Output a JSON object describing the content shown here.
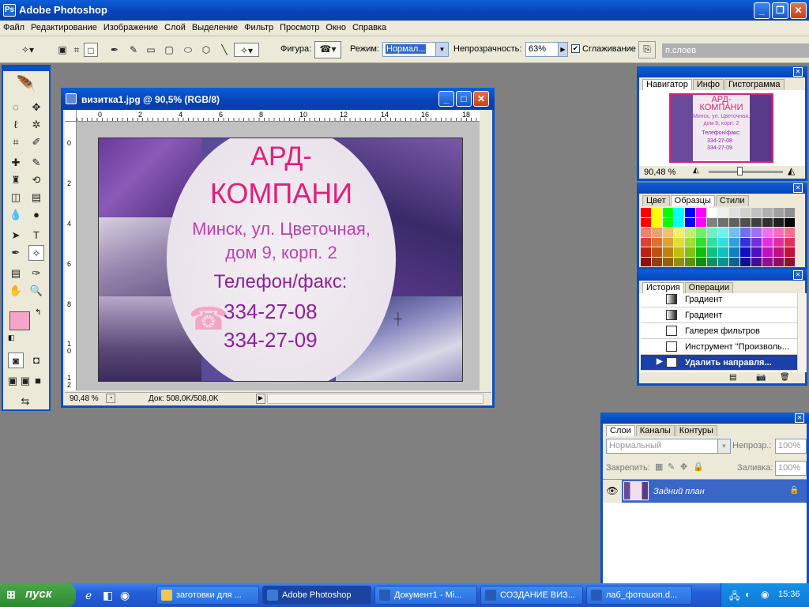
{
  "app": {
    "title": "Adobe Photoshop"
  },
  "menu": [
    "Файл",
    "Редактирование",
    "Изображение",
    "Слой",
    "Выделение",
    "Фильтр",
    "Просмотр",
    "Окно",
    "Справка"
  ],
  "options": {
    "shape_label": "Фигура:",
    "mode_label": "Режим:",
    "mode_value": "Нормал...",
    "opacity_label": "Непрозрачность:",
    "opacity_value": "63%",
    "antialias_label": "Сглаживание",
    "antialias_checked": true,
    "layers_tab": "п.слоев"
  },
  "document": {
    "title": "визитка1.jpg @ 90,5% (RGB/8)",
    "zoom": "90,48 %",
    "doc_size": "Док: 508,0K/508,0K",
    "ruler_h": [
      "0",
      "2",
      "4",
      "6",
      "8",
      "10",
      "12",
      "14",
      "16",
      "18"
    ],
    "ruler_v": [
      "0",
      "2",
      "4",
      "6",
      "8",
      "1\n0",
      "1\n2"
    ]
  },
  "card": {
    "line1": "АРД-",
    "line2": "КОМПАНИ",
    "address1": "Минск, ул. Цветочная,",
    "address2": "дом 9, корп. 2",
    "phone_label": "Телефон/факс:",
    "phone1": "334-27-08",
    "phone2": "334-27-09",
    "title_color": "#e0207a",
    "address_color": "#c040b0",
    "phone_color": "#9020a0"
  },
  "navigator": {
    "tabs": [
      "Навигатор",
      "Инфо",
      "Гистограмма"
    ],
    "zoom": "90,48 %",
    "thumb_lines": [
      "АРД-",
      "КОМПАНИ",
      "Минск, ул. Цветочная,",
      "дом 9, корп. 2",
      "Телефон/факс:",
      "334-27-08",
      "334-27-09"
    ]
  },
  "swatches": {
    "tabs": [
      "Цвет",
      "Образцы",
      "Стили"
    ],
    "colors": [
      [
        "#ff0000",
        "#ffff00",
        "#00ff00",
        "#00ffff",
        "#0000ff",
        "#ff00ff",
        "#ffffff",
        "#f0f0f0",
        "#e0e0e0",
        "#d0d0d0",
        "#c0c0c0",
        "#b0b0b0",
        "#a0a0a0",
        "#909090"
      ],
      [
        "#ff0000",
        "#ffff00",
        "#00ff00",
        "#00ffff",
        "#0000ff",
        "#ff00ff",
        "#808080",
        "#707070",
        "#606060",
        "#505050",
        "#404040",
        "#303030",
        "#202020",
        "#000000"
      ],
      [
        "#f08070",
        "#f0a070",
        "#f0c070",
        "#f0f070",
        "#c0f070",
        "#70f070",
        "#70f0c0",
        "#70f0f0",
        "#70c0f0",
        "#7070f0",
        "#a070f0",
        "#f070f0",
        "#f070c0",
        "#f07090"
      ],
      [
        "#e04030",
        "#e07030",
        "#e0a030",
        "#e0e030",
        "#a0e030",
        "#30e030",
        "#30e0a0",
        "#30e0e0",
        "#30a0e0",
        "#3030e0",
        "#7030e0",
        "#e030e0",
        "#e030a0",
        "#e03060"
      ],
      [
        "#c02010",
        "#c05010",
        "#c08010",
        "#c0c010",
        "#80c010",
        "#10c010",
        "#10c080",
        "#10c0c0",
        "#1080c0",
        "#1010c0",
        "#5010c0",
        "#c010c0",
        "#c01080",
        "#c01040"
      ],
      [
        "#901010",
        "#904010",
        "#906010",
        "#909010",
        "#609010",
        "#109010",
        "#109060",
        "#109090",
        "#106090",
        "#101090",
        "#401090",
        "#901090",
        "#901060",
        "#901030"
      ]
    ]
  },
  "history": {
    "tabs": [
      "История",
      "Операции"
    ],
    "items": [
      "Градиент",
      "Градиент",
      "Галерея фильтров",
      "Инструмент \"Произволь...",
      "Удалить направля..."
    ]
  },
  "layers": {
    "tabs": [
      "Слои",
      "Каналы",
      "Контуры"
    ],
    "blend_mode": "Нормальный",
    "opacity_label": "Непрозр.:",
    "opacity_value": "100%",
    "lock_label": "Закрепить:",
    "fill_label": "Заливка:",
    "fill_value": "100%",
    "layer_name": "Задний план"
  },
  "taskbar": {
    "start": "пуск",
    "tasks": [
      "заготовки для ...",
      "Adobe Photoshop",
      "Документ1 - Mi...",
      "СОЗДАНИЕ ВИЗ...",
      "лаб_фотошоп.d..."
    ],
    "clock": "15:36"
  }
}
